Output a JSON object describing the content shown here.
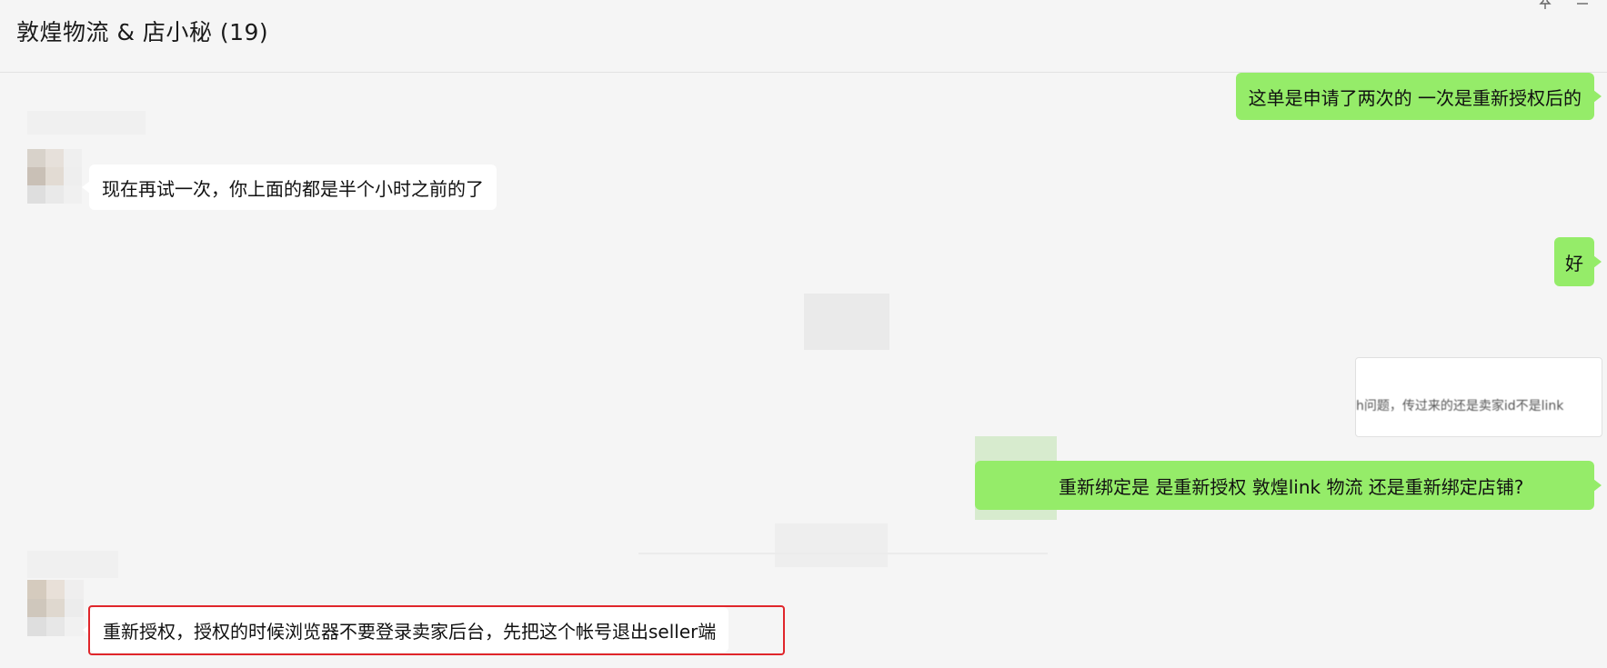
{
  "header": {
    "title": "敦煌物流 & 店小秘 (19)",
    "pin_icon": "pin-icon",
    "minimize_icon": "minimize-icon"
  },
  "messages": [
    {
      "direction": "outgoing",
      "text": "这单是申请了两次的  一次是重新授权后的"
    },
    {
      "direction": "incoming",
      "text": "现在再试一次，你上面的都是半个小时之前的了"
    },
    {
      "direction": "outgoing",
      "text": "好"
    },
    {
      "direction": "outgoing",
      "type": "quoted-image",
      "text": "h问题，传过来的还是卖家id不是link"
    },
    {
      "direction": "outgoing",
      "text": "重新绑定是 是重新授权 敦煌link  物流  还是重新绑定店铺?"
    },
    {
      "direction": "incoming",
      "text": "重新授权，授权的时候浏览器不要登录卖家后台，先把这个帐号退出seller端",
      "highlighted": true
    }
  ],
  "colors": {
    "outgoing_bubble": "#95ec69",
    "incoming_bubble": "#ffffff",
    "highlight_border": "#e0262b",
    "background": "#f5f5f5"
  }
}
